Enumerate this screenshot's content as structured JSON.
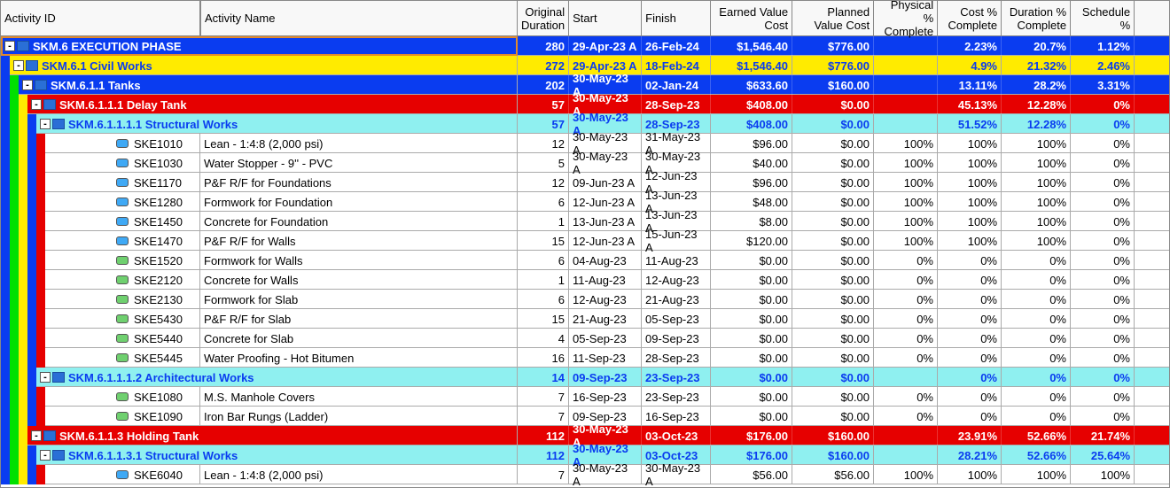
{
  "columns": {
    "activity_id": "Activity ID",
    "activity_name": "Activity Name",
    "original_duration": "Original Duration",
    "start": "Start",
    "finish": "Finish",
    "earned_value_cost": "Earned Value Cost",
    "planned_value_cost": "Planned Value Cost",
    "physical_pct_complete": "Physical % Complete",
    "cost_pct_complete": "Cost % Complete",
    "duration_pct_complete": "Duration % Complete",
    "schedule_pct": "Schedule %"
  },
  "rows": [
    {
      "type": "group",
      "level": 0,
      "bg": "blue",
      "strips": [],
      "id": "SKM.6",
      "label": "SKM.6  EXECUTION PHASE",
      "dur": "280",
      "start": "29-Apr-23 A",
      "finish": "26-Feb-24",
      "evc": "$1,546.40",
      "pvc": "$776.00",
      "phys": "",
      "cost": "2.23%",
      "durp": "20.7%",
      "sched": "1.12%",
      "expand": true,
      "outline": true
    },
    {
      "type": "group",
      "level": 1,
      "bg": "yellow",
      "strips": [
        "blue"
      ],
      "id": "SKM.6.1",
      "label": "SKM.6.1  Civil Works",
      "dur": "272",
      "start": "29-Apr-23 A",
      "finish": "18-Feb-24",
      "evc": "$1,546.40",
      "pvc": "$776.00",
      "phys": "",
      "cost": "4.9%",
      "durp": "21.32%",
      "sched": "2.46%",
      "expand": true
    },
    {
      "type": "group",
      "level": 2,
      "bg": "blue",
      "strips": [
        "blue",
        "green"
      ],
      "id": "SKM.6.1.1",
      "label": "SKM.6.1.1  Tanks",
      "dur": "202",
      "start": "30-May-23 A",
      "finish": "02-Jan-24",
      "evc": "$633.60",
      "pvc": "$160.00",
      "phys": "",
      "cost": "13.11%",
      "durp": "28.2%",
      "sched": "3.31%",
      "expand": true
    },
    {
      "type": "group",
      "level": 3,
      "bg": "red",
      "strips": [
        "blue",
        "green",
        "yellow"
      ],
      "id": "SKM.6.1.1.1",
      "label": "SKM.6.1.1.1  Delay Tank",
      "dur": "57",
      "start": "30-May-23 A",
      "finish": "28-Sep-23",
      "evc": "$408.00",
      "pvc": "$0.00",
      "phys": "",
      "cost": "45.13%",
      "durp": "12.28%",
      "sched": "0%",
      "expand": true
    },
    {
      "type": "group",
      "level": 4,
      "bg": "cyan",
      "strips": [
        "blue",
        "green",
        "yellow",
        "blue"
      ],
      "id": "SKM.6.1.1.1.1",
      "label": "SKM.6.1.1.1.1  Structural Works",
      "dur": "57",
      "start": "30-May-23 A",
      "finish": "28-Sep-23",
      "evc": "$408.00",
      "pvc": "$0.00",
      "phys": "",
      "cost": "51.52%",
      "durp": "12.28%",
      "sched": "0%",
      "expand": true
    },
    {
      "type": "leaf",
      "level": 5,
      "bg": "white",
      "strips": [
        "blue",
        "green",
        "yellow",
        "blue",
        "red"
      ],
      "icon": "blue",
      "id": "SKE1010",
      "name": "Lean - 1:4:8 (2,000 psi)",
      "dur": "12",
      "start": "30-May-23 A",
      "finish": "31-May-23 A",
      "evc": "$96.00",
      "pvc": "$0.00",
      "phys": "100%",
      "cost": "100%",
      "durp": "100%",
      "sched": "0%"
    },
    {
      "type": "leaf",
      "level": 5,
      "bg": "white",
      "strips": [
        "blue",
        "green",
        "yellow",
        "blue",
        "red"
      ],
      "icon": "blue",
      "id": "SKE1030",
      "name": "Water Stopper - 9'' - PVC",
      "dur": "5",
      "start": "30-May-23 A",
      "finish": "30-May-23 A",
      "evc": "$40.00",
      "pvc": "$0.00",
      "phys": "100%",
      "cost": "100%",
      "durp": "100%",
      "sched": "0%"
    },
    {
      "type": "leaf",
      "level": 5,
      "bg": "white",
      "strips": [
        "blue",
        "green",
        "yellow",
        "blue",
        "red"
      ],
      "icon": "blue",
      "id": "SKE1170",
      "name": "P&F R/F for Foundations",
      "dur": "12",
      "start": "09-Jun-23 A",
      "finish": "12-Jun-23 A",
      "evc": "$96.00",
      "pvc": "$0.00",
      "phys": "100%",
      "cost": "100%",
      "durp": "100%",
      "sched": "0%"
    },
    {
      "type": "leaf",
      "level": 5,
      "bg": "white",
      "strips": [
        "blue",
        "green",
        "yellow",
        "blue",
        "red"
      ],
      "icon": "blue",
      "id": "SKE1280",
      "name": "Formwork for Foundation",
      "dur": "6",
      "start": "12-Jun-23 A",
      "finish": "13-Jun-23 A",
      "evc": "$48.00",
      "pvc": "$0.00",
      "phys": "100%",
      "cost": "100%",
      "durp": "100%",
      "sched": "0%"
    },
    {
      "type": "leaf",
      "level": 5,
      "bg": "white",
      "strips": [
        "blue",
        "green",
        "yellow",
        "blue",
        "red"
      ],
      "icon": "blue",
      "id": "SKE1450",
      "name": "Concrete for Foundation",
      "dur": "1",
      "start": "13-Jun-23 A",
      "finish": "13-Jun-23 A",
      "evc": "$8.00",
      "pvc": "$0.00",
      "phys": "100%",
      "cost": "100%",
      "durp": "100%",
      "sched": "0%"
    },
    {
      "type": "leaf",
      "level": 5,
      "bg": "white",
      "strips": [
        "blue",
        "green",
        "yellow",
        "blue",
        "red"
      ],
      "icon": "blue",
      "id": "SKE1470",
      "name": "P&F R/F for Walls",
      "dur": "15",
      "start": "12-Jun-23 A",
      "finish": "15-Jun-23 A",
      "evc": "$120.00",
      "pvc": "$0.00",
      "phys": "100%",
      "cost": "100%",
      "durp": "100%",
      "sched": "0%"
    },
    {
      "type": "leaf",
      "level": 5,
      "bg": "white",
      "strips": [
        "blue",
        "green",
        "yellow",
        "blue",
        "red"
      ],
      "icon": "green",
      "id": "SKE1520",
      "name": "Formwork for Walls",
      "dur": "6",
      "start": "04-Aug-23",
      "finish": "11-Aug-23",
      "evc": "$0.00",
      "pvc": "$0.00",
      "phys": "0%",
      "cost": "0%",
      "durp": "0%",
      "sched": "0%"
    },
    {
      "type": "leaf",
      "level": 5,
      "bg": "white",
      "strips": [
        "blue",
        "green",
        "yellow",
        "blue",
        "red"
      ],
      "icon": "green",
      "id": "SKE2120",
      "name": "Concrete for Walls",
      "dur": "1",
      "start": "11-Aug-23",
      "finish": "12-Aug-23",
      "evc": "$0.00",
      "pvc": "$0.00",
      "phys": "0%",
      "cost": "0%",
      "durp": "0%",
      "sched": "0%"
    },
    {
      "type": "leaf",
      "level": 5,
      "bg": "white",
      "strips": [
        "blue",
        "green",
        "yellow",
        "blue",
        "red"
      ],
      "icon": "green",
      "id": "SKE2130",
      "name": "Formwork for Slab",
      "dur": "6",
      "start": "12-Aug-23",
      "finish": "21-Aug-23",
      "evc": "$0.00",
      "pvc": "$0.00",
      "phys": "0%",
      "cost": "0%",
      "durp": "0%",
      "sched": "0%"
    },
    {
      "type": "leaf",
      "level": 5,
      "bg": "white",
      "strips": [
        "blue",
        "green",
        "yellow",
        "blue",
        "red"
      ],
      "icon": "green",
      "id": "SKE5430",
      "name": "P&F R/F for Slab",
      "dur": "15",
      "start": "21-Aug-23",
      "finish": "05-Sep-23",
      "evc": "$0.00",
      "pvc": "$0.00",
      "phys": "0%",
      "cost": "0%",
      "durp": "0%",
      "sched": "0%"
    },
    {
      "type": "leaf",
      "level": 5,
      "bg": "white",
      "strips": [
        "blue",
        "green",
        "yellow",
        "blue",
        "red"
      ],
      "icon": "green",
      "id": "SKE5440",
      "name": "Concrete for Slab",
      "dur": "4",
      "start": "05-Sep-23",
      "finish": "09-Sep-23",
      "evc": "$0.00",
      "pvc": "$0.00",
      "phys": "0%",
      "cost": "0%",
      "durp": "0%",
      "sched": "0%"
    },
    {
      "type": "leaf",
      "level": 5,
      "bg": "white",
      "strips": [
        "blue",
        "green",
        "yellow",
        "blue",
        "red"
      ],
      "icon": "green",
      "id": "SKE5445",
      "name": "Water Proofing - Hot Bitumen",
      "dur": "16",
      "start": "11-Sep-23",
      "finish": "28-Sep-23",
      "evc": "$0.00",
      "pvc": "$0.00",
      "phys": "0%",
      "cost": "0%",
      "durp": "0%",
      "sched": "0%"
    },
    {
      "type": "group",
      "level": 4,
      "bg": "cyan",
      "strips": [
        "blue",
        "green",
        "yellow",
        "blue"
      ],
      "id": "SKM.6.1.1.1.2",
      "label": "SKM.6.1.1.1.2  Architectural Works",
      "dur": "14",
      "start": "09-Sep-23",
      "finish": "23-Sep-23",
      "evc": "$0.00",
      "pvc": "$0.00",
      "phys": "",
      "cost": "0%",
      "durp": "0%",
      "sched": "0%",
      "expand": true
    },
    {
      "type": "leaf",
      "level": 5,
      "bg": "white",
      "strips": [
        "blue",
        "green",
        "yellow",
        "blue",
        "red"
      ],
      "icon": "green",
      "id": "SKE1080",
      "name": "M.S. Manhole Covers",
      "dur": "7",
      "start": "16-Sep-23",
      "finish": "23-Sep-23",
      "evc": "$0.00",
      "pvc": "$0.00",
      "phys": "0%",
      "cost": "0%",
      "durp": "0%",
      "sched": "0%"
    },
    {
      "type": "leaf",
      "level": 5,
      "bg": "white",
      "strips": [
        "blue",
        "green",
        "yellow",
        "blue",
        "red"
      ],
      "icon": "green",
      "id": "SKE1090",
      "name": "Iron Bar Rungs (Ladder)",
      "dur": "7",
      "start": "09-Sep-23",
      "finish": "16-Sep-23",
      "evc": "$0.00",
      "pvc": "$0.00",
      "phys": "0%",
      "cost": "0%",
      "durp": "0%",
      "sched": "0%"
    },
    {
      "type": "group",
      "level": 3,
      "bg": "red",
      "strips": [
        "blue",
        "green",
        "yellow"
      ],
      "id": "SKM.6.1.1.3",
      "label": "SKM.6.1.1.3  Holding Tank",
      "dur": "112",
      "start": "30-May-23 A",
      "finish": "03-Oct-23",
      "evc": "$176.00",
      "pvc": "$160.00",
      "phys": "",
      "cost": "23.91%",
      "durp": "52.66%",
      "sched": "21.74%",
      "expand": true
    },
    {
      "type": "group",
      "level": 4,
      "bg": "cyan",
      "strips": [
        "blue",
        "green",
        "yellow",
        "blue"
      ],
      "id": "SKM.6.1.1.3.1",
      "label": "SKM.6.1.1.3.1  Structural Works",
      "dur": "112",
      "start": "30-May-23 A",
      "finish": "03-Oct-23",
      "evc": "$176.00",
      "pvc": "$160.00",
      "phys": "",
      "cost": "28.21%",
      "durp": "52.66%",
      "sched": "25.64%",
      "expand": true
    },
    {
      "type": "leaf",
      "level": 5,
      "bg": "white",
      "strips": [
        "blue",
        "green",
        "yellow",
        "blue",
        "red"
      ],
      "icon": "blue",
      "id": "SKE6040",
      "name": "Lean - 1:4:8 (2,000 psi)",
      "dur": "7",
      "start": "30-May-23 A",
      "finish": "30-May-23 A",
      "evc": "$56.00",
      "pvc": "$56.00",
      "phys": "100%",
      "cost": "100%",
      "durp": "100%",
      "sched": "100%"
    }
  ],
  "stripColors": {
    "blue": "#0a3cf0",
    "green": "#00e000",
    "yellow": "#ffeb00",
    "red": "#e60000"
  }
}
